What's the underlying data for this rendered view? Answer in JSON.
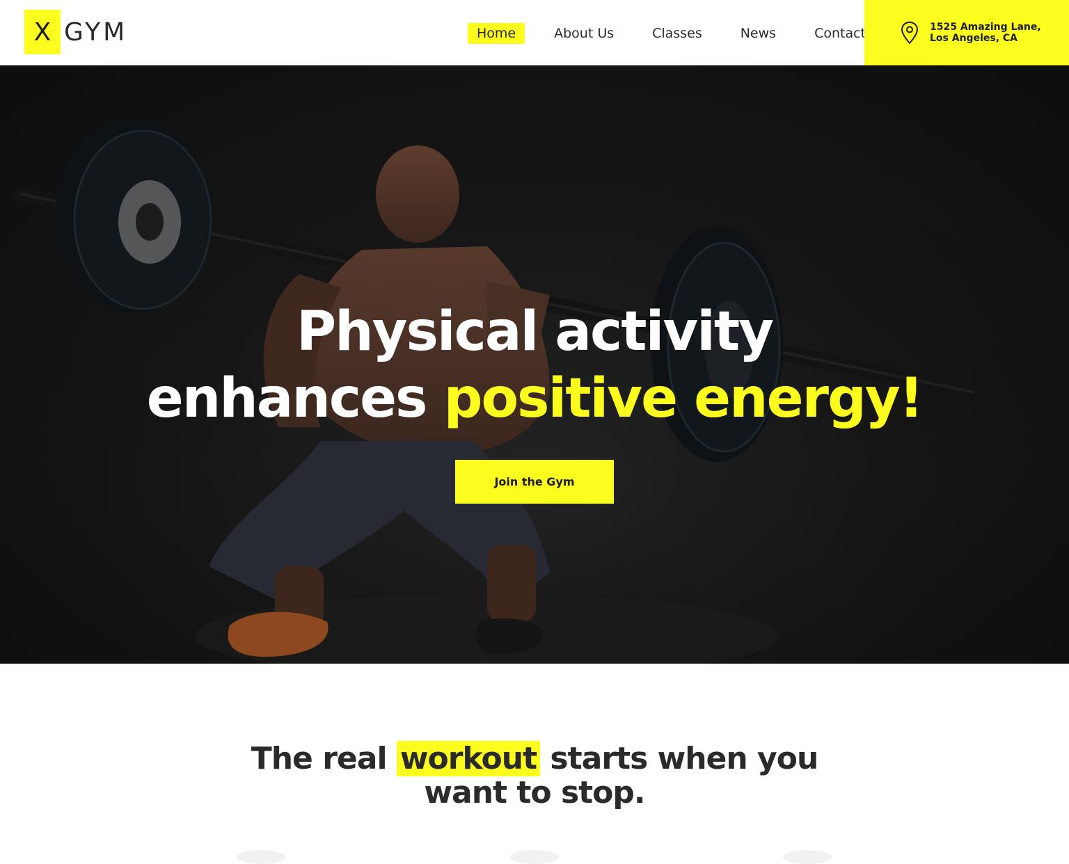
{
  "header": {
    "logo": {
      "mark": "X",
      "word": "GYM"
    },
    "nav": [
      {
        "label": "Home",
        "active": true
      },
      {
        "label": "About Us",
        "active": false
      },
      {
        "label": "Classes",
        "active": false
      },
      {
        "label": "News",
        "active": false
      },
      {
        "label": "Contact",
        "active": false
      }
    ],
    "address": {
      "icon": "map-pin-icon",
      "line1": "1525 Amazing Lane,",
      "line2": "Los Angeles, CA"
    }
  },
  "hero": {
    "title_line1": "Physical activity",
    "title_line2_plain": "enhances ",
    "title_line2_accent": "positive energy!",
    "button_label": "Join the Gym"
  },
  "tagline": {
    "before": "The real ",
    "highlight": "workout",
    "after": " starts when you",
    "line2": "want to stop."
  },
  "colors": {
    "accent": "#fcfc1e",
    "text": "#2a2a2a",
    "hero_bg": "#1c1c1c"
  }
}
